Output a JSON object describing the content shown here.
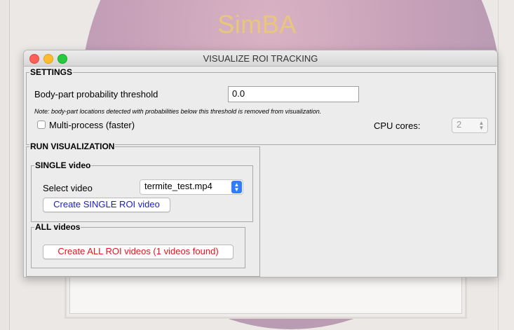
{
  "background": {
    "app_title": "SimBA"
  },
  "dialog": {
    "title": "VISUALIZE ROI TRACKING",
    "settings": {
      "group_label": "SETTINGS",
      "threshold_label": "Body-part probability threshold",
      "threshold_value": "0.0",
      "note": "Note: body-part locations detected with probabilities below this threshold is removed from visualization.",
      "multiprocess_label": "Multi-process (faster)",
      "multiprocess_checked": false,
      "cpu_cores_label": "CPU cores:",
      "cpu_cores_value": "2"
    },
    "run_visualization": {
      "group_label": "RUN VISUALIZATION",
      "single": {
        "group_label": "SINGLE video",
        "select_label": "Select video",
        "selected_video": "termite_test.mp4",
        "create_button": "Create SINGLE ROI video",
        "create_button_color": "#1a1acc"
      },
      "all": {
        "group_label": "ALL videos",
        "create_button": "Create ALL ROI videos (1 videos found)",
        "create_button_color": "#e0161b"
      }
    }
  }
}
